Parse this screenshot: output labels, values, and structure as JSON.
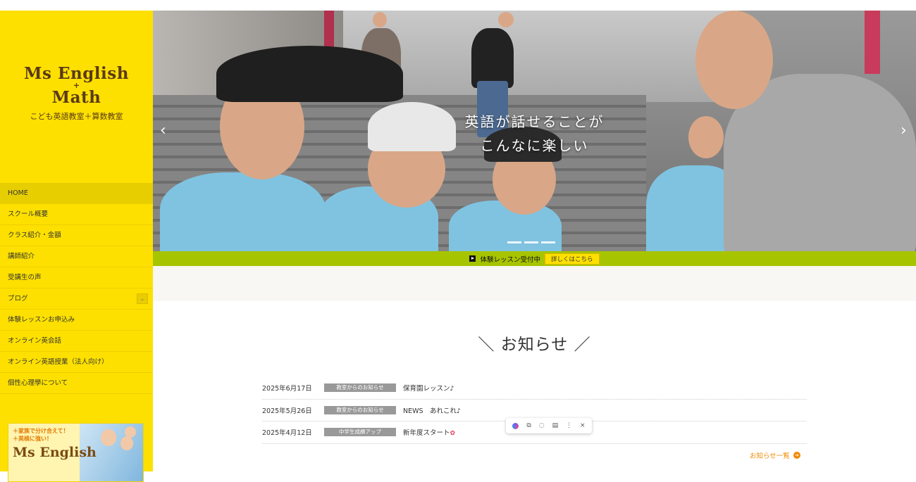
{
  "logo": {
    "line1": "Ms English",
    "plus": "+",
    "line2": "Math",
    "subtitle": "こども英語教室＋算数教室"
  },
  "nav": {
    "items": [
      {
        "label": "HOME"
      },
      {
        "label": "スクール概要"
      },
      {
        "label": "クラス紹介・金額"
      },
      {
        "label": "講師紹介"
      },
      {
        "label": "受講生の声"
      },
      {
        "label": "ブログ"
      },
      {
        "label": "体験レッスンお申込み"
      },
      {
        "label": "オンライン英会話"
      },
      {
        "label": "オンライン英語授業（法人向け）"
      },
      {
        "label": "個性心理學について"
      }
    ],
    "blog_toggle": "⌄"
  },
  "promo": {
    "line1": "＋家族で分け合えて！",
    "line2": "＋英検に強い！",
    "title": "Ms English"
  },
  "hero": {
    "line1": "英語が話せることが",
    "line2": "こんなに楽しい",
    "prev": "‹",
    "next": "›"
  },
  "trial_bar": {
    "text": "体験レッスン受付中",
    "button": "詳しくはこちら"
  },
  "news": {
    "title": "＼ お知らせ ／",
    "rows": [
      {
        "date": "2025年6月17日",
        "category": "教室からのお知らせ",
        "text": "保育園レッスン♪"
      },
      {
        "date": "2025年5月26日",
        "category": "教室からのお知らせ",
        "text": "NEWS　あれこれ♪"
      },
      {
        "date": "2025年4月12日",
        "category": "中学生成績アップ",
        "text": "新年度スタート"
      }
    ],
    "more": "お知らせ一覧",
    "flower": "✿"
  },
  "floating_toolbar": {
    "more": "⋮",
    "close": "×"
  },
  "colors": {
    "sidebar": "#fde000",
    "trial_bar": "#a7c400",
    "accent": "#f08a00",
    "brand_text": "#5a3a16"
  }
}
